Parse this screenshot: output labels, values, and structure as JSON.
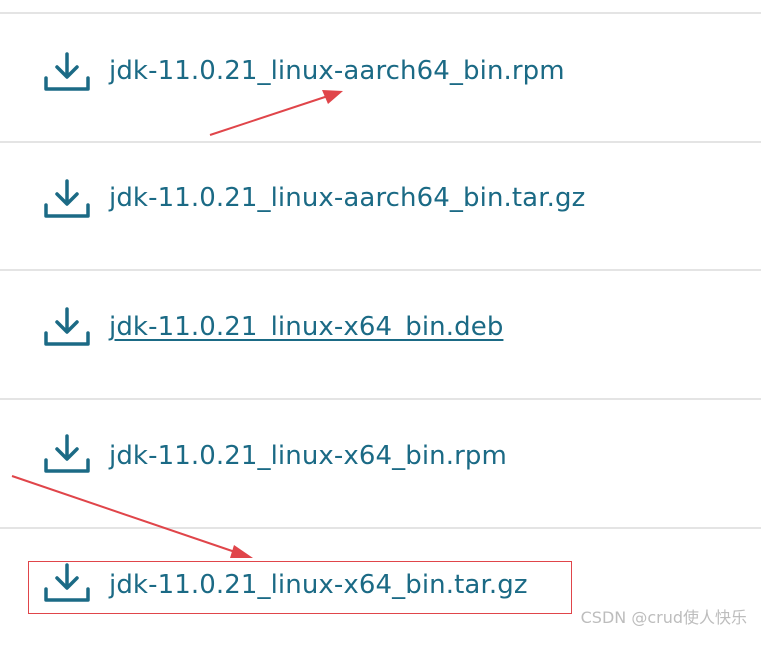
{
  "downloads": {
    "items": [
      {
        "filename": "jdk-11.0.21_linux-aarch64_bin.rpm",
        "icon": "download-icon"
      },
      {
        "filename": "jdk-11.0.21_linux-aarch64_bin.tar.gz",
        "icon": "download-icon"
      },
      {
        "filename": "jdk-11.0.21_linux-x64_bin.deb",
        "icon": "download-icon"
      },
      {
        "filename": "jdk-11.0.21_linux-x64_bin.rpm",
        "icon": "download-icon"
      },
      {
        "filename": "jdk-11.0.21_linux-x64_bin.tar.gz",
        "icon": "download-icon"
      }
    ]
  },
  "watermark": {
    "text": "CSDN @crud使人快乐"
  },
  "colors": {
    "link": "#1b6a85",
    "annotation": "#e0454a",
    "divider": "#e4e4e4"
  }
}
